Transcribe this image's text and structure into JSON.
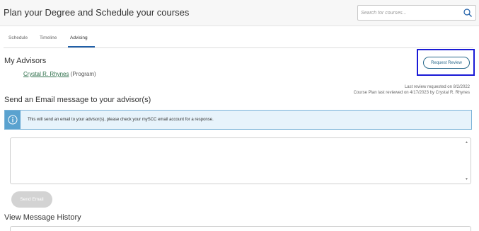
{
  "header": {
    "title": "Plan your Degree and Schedule your courses",
    "search_placeholder": "Search for courses..."
  },
  "tabs": [
    {
      "label": "Schedule",
      "active": false
    },
    {
      "label": "Timeline",
      "active": false
    },
    {
      "label": "Advising",
      "active": true
    }
  ],
  "advisors": {
    "heading": "My Advisors",
    "list": [
      {
        "name": "Crystal R. Rhynes",
        "role": "(Program)"
      }
    ],
    "request_review_label": "Request Review",
    "last_review_requested": "Last review requested on 8/2/2022",
    "last_reviewed": "Course Plan last reviewed on 4/17/2023 by Crystal R. Rhynes"
  },
  "email": {
    "heading": "Send an Email message to your advisor(s)",
    "info_text": "This will send an email to your advisor(s), please check your mySCC email account for a response.",
    "message_value": "",
    "send_label": "Send Email"
  },
  "history": {
    "heading": "View Message History"
  },
  "colors": {
    "accent": "#1f5fa8",
    "link": "#2c6e49",
    "info_bg": "#e7f3fb",
    "info_icon_bg": "#5aa2cf",
    "highlight_border": "#1a1ad6",
    "disabled_button": "#d3d3d3"
  },
  "icons": {
    "search": "search-icon",
    "info": "info-icon"
  }
}
